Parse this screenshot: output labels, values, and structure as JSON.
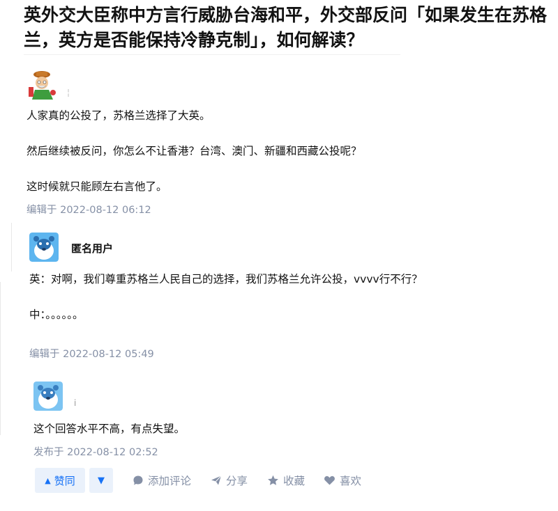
{
  "question": {
    "title": "英外交大臣称中方言行威胁台海和平，外交部反问「如果发生在苏格兰，英方是否能保持冷静克制」，如何解读？"
  },
  "answer1": {
    "icon": "cartoon-avatar",
    "paragraphs": [
      "人家真的公投了，苏格兰选择了大英。",
      "然后继续被反问，你怎么不让香港？台湾、澳门、新疆和西藏公投呢？",
      "这时候就只能顾左右言他了。"
    ],
    "meta": "编辑于 2022-08-12 06:12"
  },
  "answer2": {
    "author": "匿名用户",
    "icon": "anonymous-avatar",
    "paragraphs": [
      "英：对啊，我们尊重苏格兰人民自己的选择，我们苏格兰允许公投，vvvv行不行？",
      "中：。。。。。。"
    ],
    "meta": "编辑于 2022-08-12 05:49"
  },
  "answer3": {
    "icon": "anonymous-avatar",
    "fragment": "i",
    "paragraphs": [
      "这个回答水平不高，有点失望。"
    ],
    "meta": "发布于 2022-08-12 02:52"
  },
  "actions": {
    "upvote": "赞同",
    "comment": "添加评论",
    "share": "分享",
    "favorite": "收藏",
    "like": "喜欢"
  },
  "colors": {
    "accent": "#1772f6",
    "vote_bg": "#eaf1fb",
    "meta": "#8590a6",
    "avatar_blue": "#5db5ef"
  }
}
